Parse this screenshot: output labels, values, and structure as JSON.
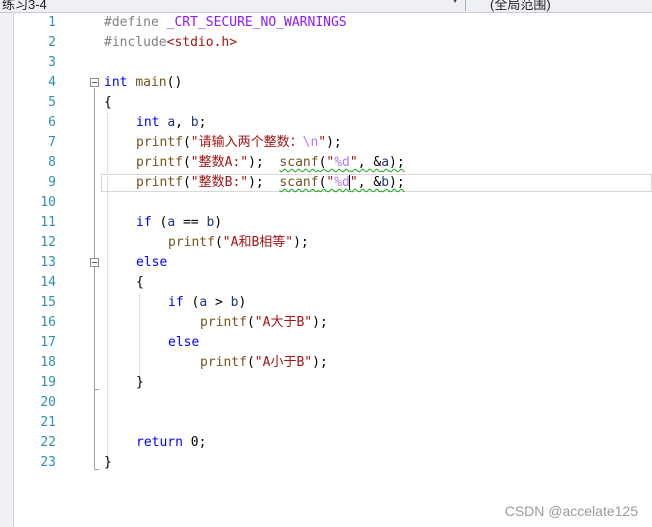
{
  "toolbar": {
    "project_dropdown": "练习3-4",
    "scope_dropdown": "(全局范围)"
  },
  "editor": {
    "line_numbers": [
      "1",
      "2",
      "3",
      "4",
      "5",
      "6",
      "7",
      "8",
      "9",
      "10",
      "11",
      "12",
      "13",
      "14",
      "15",
      "16",
      "17",
      "18",
      "19",
      "20",
      "21",
      "22",
      "23"
    ],
    "lines": {
      "l1": {
        "t0": "#define ",
        "t1": "_CRT_SECURE_NO_WARNINGS"
      },
      "l2": {
        "t0": "#include",
        "t1": "<stdio.h>"
      },
      "l4": {
        "t0": "int",
        "t1": " ",
        "t2": "main",
        "t3": "()"
      },
      "l5": {
        "t0": "{"
      },
      "l6": {
        "t0": "int",
        "t1": " ",
        "t2": "a",
        "t3": ", ",
        "t4": "b",
        "t5": ";"
      },
      "l7": {
        "t0": "printf",
        "t1": "(",
        "t2": "\"请输入两个整数：",
        "t3": "\\n",
        "t4": "\"",
        "t5": ");"
      },
      "l8": {
        "t0": "printf",
        "t1": "(",
        "t2": "\"整数A:\"",
        "t3": ");  ",
        "t4": "scanf",
        "t5": "(",
        "t6": "\"",
        "t7": "%d",
        "t8": "\"",
        "t9": ", &",
        "t10": "a",
        "t11": ");"
      },
      "l9": {
        "t0": "printf",
        "t1": "(",
        "t2": "\"整数B:\"",
        "t3": ");  ",
        "t4": "scanf",
        "t5": "(",
        "t6": "\"",
        "t7": "%d",
        "t8": "\"",
        "t9": ", &",
        "t10": "b",
        "t11": ");"
      },
      "l11": {
        "t0": "if",
        "t1": " (",
        "t2": "a",
        "t3": " == ",
        "t4": "b",
        "t5": ")"
      },
      "l12": {
        "t0": "printf",
        "t1": "(",
        "t2": "\"A和B相等\"",
        "t3": ");"
      },
      "l13": {
        "t0": "else"
      },
      "l14": {
        "t0": "{"
      },
      "l15": {
        "t0": "if",
        "t1": " (",
        "t2": "a",
        "t3": " > ",
        "t4": "b",
        "t5": ")"
      },
      "l16": {
        "t0": "printf",
        "t1": "(",
        "t2": "\"A大于B\"",
        "t3": ");"
      },
      "l17": {
        "t0": "else"
      },
      "l18": {
        "t0": "printf",
        "t1": "(",
        "t2": "\"A小于B\"",
        "t3": ");"
      },
      "l19": {
        "t0": "}"
      },
      "l22": {
        "t0": "return",
        "t1": " 0;"
      },
      "l23": {
        "t0": "}"
      }
    }
  },
  "watermark": "CSDN @accelate125",
  "colors": {
    "keyword": "#0000ff",
    "preprocessor": "#808080",
    "function": "#74531f",
    "string": "#a31515",
    "escape": "#b776fb",
    "line_number": "#2b91af",
    "squiggle": "#17a217"
  }
}
